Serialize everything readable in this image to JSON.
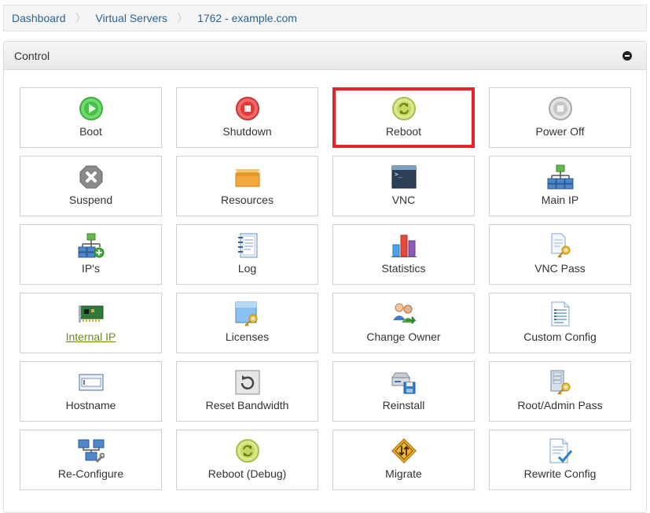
{
  "breadcrumb": [
    "Dashboard",
    "Virtual Servers",
    "1762 - example.com"
  ],
  "panel": {
    "title": "Control"
  },
  "tiles": [
    {
      "label": "Boot",
      "icon": "play-icon"
    },
    {
      "label": "Shutdown",
      "icon": "stop-icon"
    },
    {
      "label": "Reboot",
      "icon": "reboot-icon",
      "selected": true
    },
    {
      "label": "Power Off",
      "icon": "power-off-icon"
    },
    {
      "label": "Suspend",
      "icon": "suspend-icon"
    },
    {
      "label": "Resources",
      "icon": "resources-icon"
    },
    {
      "label": "VNC",
      "icon": "vnc-terminal-icon"
    },
    {
      "label": "Main IP",
      "icon": "network-icon"
    },
    {
      "label": "IP's",
      "icon": "network-add-icon"
    },
    {
      "label": "Log",
      "icon": "log-notebook-icon"
    },
    {
      "label": "Statistics",
      "icon": "statistics-chart-icon"
    },
    {
      "label": "VNC Pass",
      "icon": "key-document-icon"
    },
    {
      "label": "Internal IP",
      "icon": "network-card-icon",
      "link": true
    },
    {
      "label": "Licenses",
      "icon": "license-key-icon"
    },
    {
      "label": "Change Owner",
      "icon": "change-owner-icon"
    },
    {
      "label": "Custom Config",
      "icon": "config-document-icon"
    },
    {
      "label": "Hostname",
      "icon": "hostname-field-icon"
    },
    {
      "label": "Reset Bandwidth",
      "icon": "reset-icon"
    },
    {
      "label": "Reinstall",
      "icon": "reinstall-icon"
    },
    {
      "label": "Root/Admin Pass",
      "icon": "root-pass-key-icon"
    },
    {
      "label": "Re-Configure",
      "icon": "reconfigure-icon"
    },
    {
      "label": "Reboot (Debug)",
      "icon": "reboot-debug-icon"
    },
    {
      "label": "Migrate",
      "icon": "migrate-sign-icon"
    },
    {
      "label": "Rewrite Config",
      "icon": "rewrite-config-icon"
    }
  ]
}
